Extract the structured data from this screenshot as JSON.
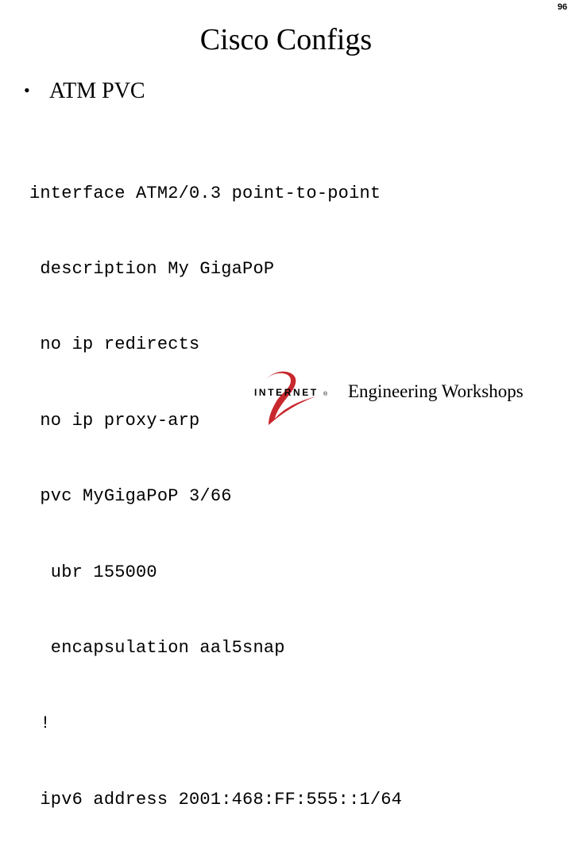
{
  "slide": {
    "number": "96",
    "title": "Cisco Configs",
    "bullet": {
      "marker": "•",
      "text": "ATM PVC"
    },
    "config_lines": [
      "interface ATM2/0.3 point-to-point",
      " description My GigaPoP",
      " no ip redirects",
      " no ip proxy-arp",
      " pvc MyGigaPoP 3/66",
      "  ubr 155000",
      "  encapsulation aal5snap",
      " !",
      " ipv6 address 2001:468:FF:555::1/64"
    ]
  },
  "footer": {
    "logo": {
      "icon": "internet2-logo-icon",
      "wordmark": "INTERNET",
      "registered_mark": "®",
      "numeral_color": "#c8282d"
    },
    "text": "Engineering Workshops"
  }
}
